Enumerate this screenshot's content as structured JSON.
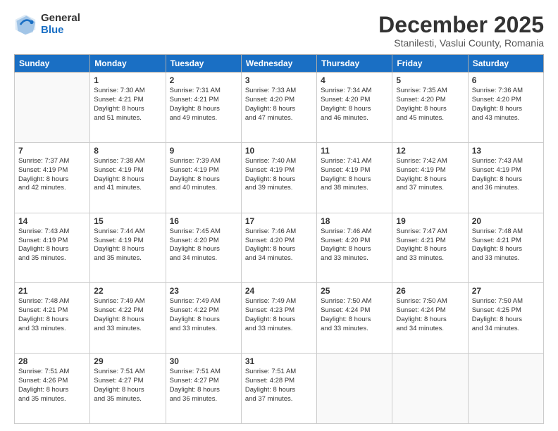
{
  "logo": {
    "general": "General",
    "blue": "Blue"
  },
  "header": {
    "month": "December 2025",
    "location": "Stanilesti, Vaslui County, Romania"
  },
  "weekdays": [
    "Sunday",
    "Monday",
    "Tuesday",
    "Wednesday",
    "Thursday",
    "Friday",
    "Saturday"
  ],
  "weeks": [
    [
      {
        "day": "",
        "info": ""
      },
      {
        "day": "1",
        "info": "Sunrise: 7:30 AM\nSunset: 4:21 PM\nDaylight: 8 hours\nand 51 minutes."
      },
      {
        "day": "2",
        "info": "Sunrise: 7:31 AM\nSunset: 4:21 PM\nDaylight: 8 hours\nand 49 minutes."
      },
      {
        "day": "3",
        "info": "Sunrise: 7:33 AM\nSunset: 4:20 PM\nDaylight: 8 hours\nand 47 minutes."
      },
      {
        "day": "4",
        "info": "Sunrise: 7:34 AM\nSunset: 4:20 PM\nDaylight: 8 hours\nand 46 minutes."
      },
      {
        "day": "5",
        "info": "Sunrise: 7:35 AM\nSunset: 4:20 PM\nDaylight: 8 hours\nand 45 minutes."
      },
      {
        "day": "6",
        "info": "Sunrise: 7:36 AM\nSunset: 4:20 PM\nDaylight: 8 hours\nand 43 minutes."
      }
    ],
    [
      {
        "day": "7",
        "info": "Sunrise: 7:37 AM\nSunset: 4:19 PM\nDaylight: 8 hours\nand 42 minutes."
      },
      {
        "day": "8",
        "info": "Sunrise: 7:38 AM\nSunset: 4:19 PM\nDaylight: 8 hours\nand 41 minutes."
      },
      {
        "day": "9",
        "info": "Sunrise: 7:39 AM\nSunset: 4:19 PM\nDaylight: 8 hours\nand 40 minutes."
      },
      {
        "day": "10",
        "info": "Sunrise: 7:40 AM\nSunset: 4:19 PM\nDaylight: 8 hours\nand 39 minutes."
      },
      {
        "day": "11",
        "info": "Sunrise: 7:41 AM\nSunset: 4:19 PM\nDaylight: 8 hours\nand 38 minutes."
      },
      {
        "day": "12",
        "info": "Sunrise: 7:42 AM\nSunset: 4:19 PM\nDaylight: 8 hours\nand 37 minutes."
      },
      {
        "day": "13",
        "info": "Sunrise: 7:43 AM\nSunset: 4:19 PM\nDaylight: 8 hours\nand 36 minutes."
      }
    ],
    [
      {
        "day": "14",
        "info": "Sunrise: 7:43 AM\nSunset: 4:19 PM\nDaylight: 8 hours\nand 35 minutes."
      },
      {
        "day": "15",
        "info": "Sunrise: 7:44 AM\nSunset: 4:19 PM\nDaylight: 8 hours\nand 35 minutes."
      },
      {
        "day": "16",
        "info": "Sunrise: 7:45 AM\nSunset: 4:20 PM\nDaylight: 8 hours\nand 34 minutes."
      },
      {
        "day": "17",
        "info": "Sunrise: 7:46 AM\nSunset: 4:20 PM\nDaylight: 8 hours\nand 34 minutes."
      },
      {
        "day": "18",
        "info": "Sunrise: 7:46 AM\nSunset: 4:20 PM\nDaylight: 8 hours\nand 33 minutes."
      },
      {
        "day": "19",
        "info": "Sunrise: 7:47 AM\nSunset: 4:21 PM\nDaylight: 8 hours\nand 33 minutes."
      },
      {
        "day": "20",
        "info": "Sunrise: 7:48 AM\nSunset: 4:21 PM\nDaylight: 8 hours\nand 33 minutes."
      }
    ],
    [
      {
        "day": "21",
        "info": "Sunrise: 7:48 AM\nSunset: 4:21 PM\nDaylight: 8 hours\nand 33 minutes."
      },
      {
        "day": "22",
        "info": "Sunrise: 7:49 AM\nSunset: 4:22 PM\nDaylight: 8 hours\nand 33 minutes."
      },
      {
        "day": "23",
        "info": "Sunrise: 7:49 AM\nSunset: 4:22 PM\nDaylight: 8 hours\nand 33 minutes."
      },
      {
        "day": "24",
        "info": "Sunrise: 7:49 AM\nSunset: 4:23 PM\nDaylight: 8 hours\nand 33 minutes."
      },
      {
        "day": "25",
        "info": "Sunrise: 7:50 AM\nSunset: 4:24 PM\nDaylight: 8 hours\nand 33 minutes."
      },
      {
        "day": "26",
        "info": "Sunrise: 7:50 AM\nSunset: 4:24 PM\nDaylight: 8 hours\nand 34 minutes."
      },
      {
        "day": "27",
        "info": "Sunrise: 7:50 AM\nSunset: 4:25 PM\nDaylight: 8 hours\nand 34 minutes."
      }
    ],
    [
      {
        "day": "28",
        "info": "Sunrise: 7:51 AM\nSunset: 4:26 PM\nDaylight: 8 hours\nand 35 minutes."
      },
      {
        "day": "29",
        "info": "Sunrise: 7:51 AM\nSunset: 4:27 PM\nDaylight: 8 hours\nand 35 minutes."
      },
      {
        "day": "30",
        "info": "Sunrise: 7:51 AM\nSunset: 4:27 PM\nDaylight: 8 hours\nand 36 minutes."
      },
      {
        "day": "31",
        "info": "Sunrise: 7:51 AM\nSunset: 4:28 PM\nDaylight: 8 hours\nand 37 minutes."
      },
      {
        "day": "",
        "info": ""
      },
      {
        "day": "",
        "info": ""
      },
      {
        "day": "",
        "info": ""
      }
    ]
  ]
}
